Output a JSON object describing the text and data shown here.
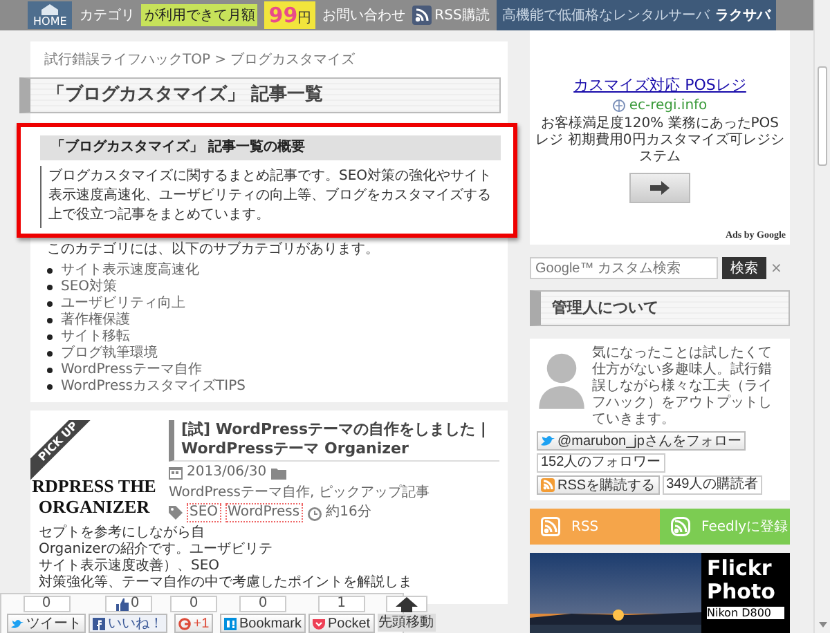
{
  "header": {
    "nav": [
      {
        "label": "HOME",
        "kind": "home"
      },
      {
        "label": "カテゴリ",
        "kind": "link"
      },
      {
        "label": "お問い合わせ",
        "kind": "link"
      },
      {
        "label": "RSS購読",
        "kind": "rss"
      }
    ],
    "banner": {
      "text": "が利用できて月額",
      "price": "99",
      "unit": "円",
      "tagline": "高機能で低価格なレンタルサーバ",
      "brand": "ラクサバ"
    }
  },
  "breadcrumb": "試行錯誤ライフハックTOP > ブログカスタマイズ",
  "page_title": "「ブログカスタマイズ」 記事一覧",
  "summary": {
    "highlighted": true,
    "heading": "「ブログカスタマイズ」 記事一覧の概要",
    "text": "ブログカスタマイズに関するまとめ記事です。SEO対策の強化やサイト表示速度高速化、ユーザビリティの向上等、ブログをカスタマイズする上で役立つ記事をまとめています。"
  },
  "subcategory_intro": "このカテゴリには、以下のサブカテゴリがあります。",
  "subcategories": [
    "サイト表示速度高速化",
    "SEO対策",
    "ユーザビリティ向上",
    "著作権保護",
    "サイト移転",
    "ブログ執筆環境",
    "WordPressテーマ自作",
    "WordPressカスタマイズTIPS"
  ],
  "article": {
    "badge": "PICK UP",
    "thumbnail_lines": [
      "RDPRESS THE",
      "ORGANIZER"
    ],
    "title": "[試] WordPressテーマの自作をしました | WordPressテーマ Organizer",
    "date": "2013/06/30",
    "categories": "WordPressテーマ自作, ピックアップ記事",
    "tags": [
      "SEO",
      "WordPress"
    ],
    "read_time": "約16分",
    "excerpt_lines": [
      "セプトを参考にしながら自",
      "Organizerの紹介です。ユーザビリテ",
      "サイト表示速度改善）、SEO",
      "対策強化等、テーマ自作の中で考慮したポイントを解説しま"
    ]
  },
  "share_bar": [
    {
      "kind": "twitter",
      "count": "0",
      "label": "ツイート"
    },
    {
      "kind": "facebook",
      "count": "0",
      "label": "いいね！"
    },
    {
      "kind": "google",
      "count": "0",
      "label": "+1"
    },
    {
      "kind": "hatena",
      "count": "0",
      "label": "Bookmark"
    },
    {
      "kind": "pocket",
      "count": "1",
      "label": "Pocket"
    },
    {
      "kind": "top",
      "label": "先頭移動"
    }
  ],
  "ad": {
    "title": "カスマイズ対応 POSレジ",
    "domain": "ec-regi.info",
    "text": "お客様満足度120% 業務にあったPOSレジ 初期費用0円カスタマイズ可レジシステム",
    "credit": "Ads by Google"
  },
  "search": {
    "placeholder": "Google™ カスタム検索",
    "button": "検索",
    "clear": "×"
  },
  "about": {
    "heading": "管理人について",
    "bio": "気になったことは試したくて仕方がない多趣味人。試行錯誤しながら様々な工夫（ライフハック）をアウトプットしていきます。",
    "follow_button": "@marubon_jpさんをフォロー",
    "followers": "152人のフォロワー",
    "rss_button": "RSSを購読する",
    "subscribers": "349人の購読者"
  },
  "subscribe": [
    {
      "kind": "rss",
      "label": "RSS",
      "color": "#f5a54a"
    },
    {
      "kind": "feedly",
      "label": "Feedlyに登録",
      "color": "#7ccc52"
    }
  ],
  "flickr": {
    "title_lines": [
      "Flickr",
      "Photo"
    ],
    "caption": "Nikon D800"
  }
}
